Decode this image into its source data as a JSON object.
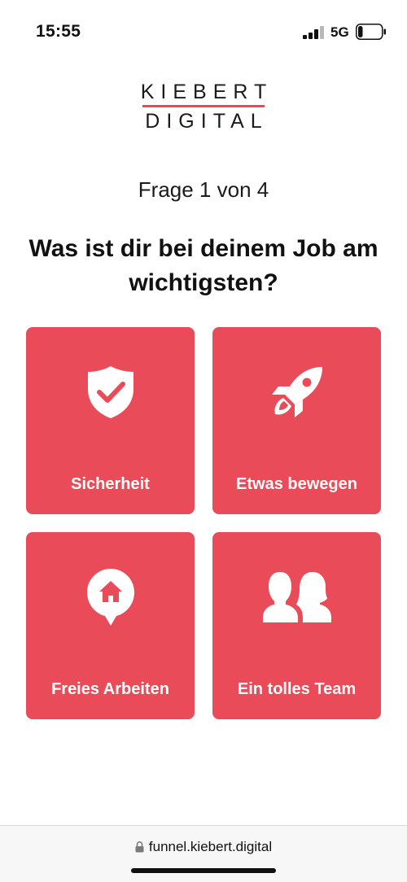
{
  "status_bar": {
    "time": "15:55",
    "network": "5G",
    "battery_level": 0.2
  },
  "logo": {
    "line1": "KIEBERT",
    "line2": "DIGITAL",
    "accent_color": "#e64a5a"
  },
  "quiz": {
    "progress": "Frage 1 von 4",
    "question": "Was ist dir bei deinem Job am wichtigsten?",
    "card_color": "#e94b59",
    "options": [
      {
        "label": "Sicherheit",
        "icon": "shield-check-icon"
      },
      {
        "label": "Etwas bewegen",
        "icon": "rocket-icon"
      },
      {
        "label": "Freies Arbeiten",
        "icon": "home-pin-icon"
      },
      {
        "label": "Ein tolles Team",
        "icon": "people-icon"
      }
    ]
  },
  "browser": {
    "url": "funnel.kiebert.digital"
  }
}
